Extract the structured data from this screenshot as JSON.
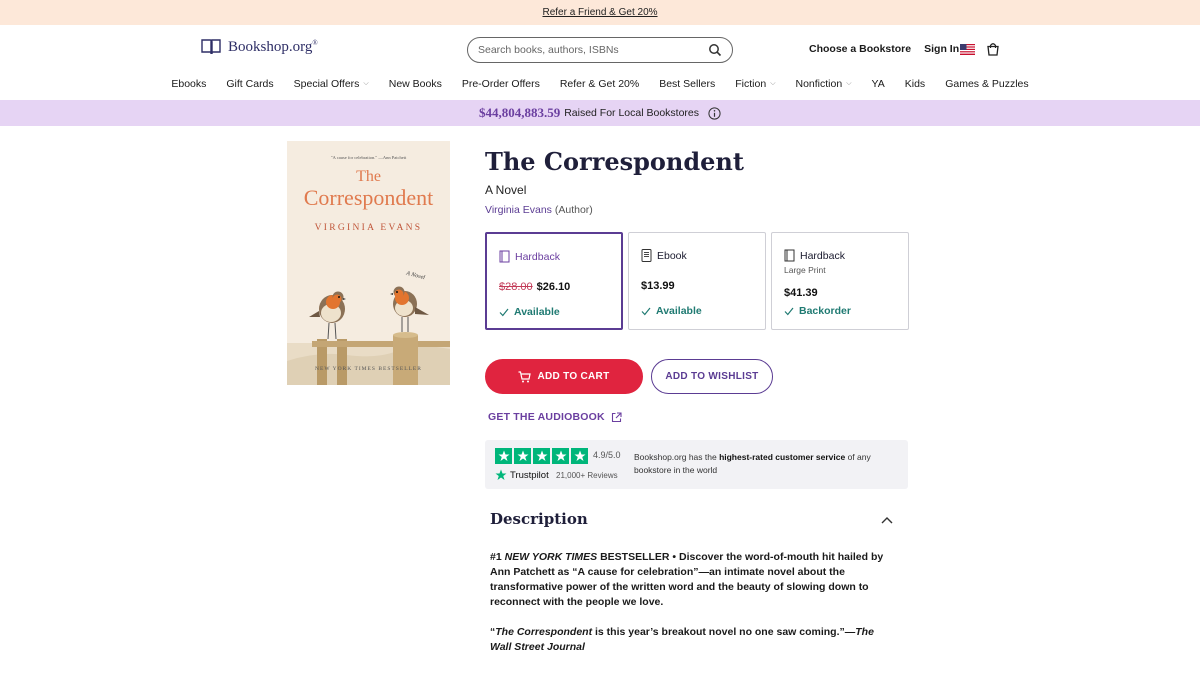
{
  "promo": {
    "link": "Refer a Friend & Get 20%"
  },
  "header": {
    "logo_text": "Bookshop.org",
    "logo_reg": "®",
    "search_placeholder": "Search books, authors, ISBNs",
    "choose_bookstore": "Choose a Bookstore",
    "sign_in": "Sign In"
  },
  "nav": {
    "items": [
      {
        "label": "Ebooks",
        "dropdown": false
      },
      {
        "label": "Gift Cards",
        "dropdown": false
      },
      {
        "label": "Special Offers",
        "dropdown": true
      },
      {
        "label": "New Books",
        "dropdown": false
      },
      {
        "label": "Pre-Order Offers",
        "dropdown": false
      },
      {
        "label": "Refer & Get 20%",
        "dropdown": false
      },
      {
        "label": "Best Sellers",
        "dropdown": false
      },
      {
        "label": "Fiction",
        "dropdown": true
      },
      {
        "label": "Nonfiction",
        "dropdown": true
      },
      {
        "label": "YA",
        "dropdown": false
      },
      {
        "label": "Kids",
        "dropdown": false
      },
      {
        "label": "Games & Puzzles",
        "dropdown": false
      }
    ]
  },
  "raised": {
    "amount": "$44,804,883.59",
    "text": "Raised For Local Bookstores"
  },
  "cover": {
    "quote": "\"A cause for celebration.\" —Ann Patchett",
    "title_line1": "The",
    "title_line2": "Correspondent",
    "author": "VIRGINIA EVANS",
    "novel": "A Novel",
    "bestseller": "NEW YORK TIMES BESTSELLER"
  },
  "book": {
    "title": "The Correspondent",
    "subtitle": "A Novel",
    "author": "Virginia Evans",
    "author_role": "(Author)"
  },
  "formats": [
    {
      "name": "Hardback",
      "note": "",
      "old_price": "$28.00",
      "price": "$26.10",
      "status": "Available",
      "selected": true
    },
    {
      "name": "Ebook",
      "note": "",
      "old_price": "",
      "price": "$13.99",
      "status": "Available",
      "selected": false
    },
    {
      "name": "Hardback",
      "note": "Large Print",
      "old_price": "",
      "price": "$41.39",
      "status": "Backorder",
      "selected": false
    }
  ],
  "actions": {
    "add_to_cart": "ADD TO CART",
    "add_to_wishlist": "ADD TO WISHLIST",
    "audiobook": "GET THE AUDIOBOOK"
  },
  "trust": {
    "score": "4.9/5.0",
    "brand": "Trustpilot",
    "reviews": "21,000+ Reviews",
    "text_pre": "Bookshop.org has the ",
    "text_bold": "highest-rated customer service",
    "text_post": " of any bookstore in the world"
  },
  "description": {
    "heading": "Description",
    "p1_a": "#1 ",
    "p1_italic": "NEW YORK TIMES",
    "p1_b": " BESTSELLER • Discover the word-of-mouth hit hailed by Ann Patchett as “A cause for celebration”—an intimate novel about the transformative power of the written word and the beauty of slowing down to reconnect with the people we love.",
    "p2_a": "“",
    "p2_italic": "The Correspondent",
    "p2_b": " is this year’s breakout novel no one saw coming.”—",
    "p2_italic2": "The Wall Street Journal"
  },
  "colors": {
    "accent_purple": "#5b3c93",
    "cart_red": "#e0243f",
    "available_teal": "#1f7a72",
    "trustpilot_green": "#00b67a",
    "raised_bg": "#e6d4f4",
    "promo_bg": "#fde8d9"
  }
}
